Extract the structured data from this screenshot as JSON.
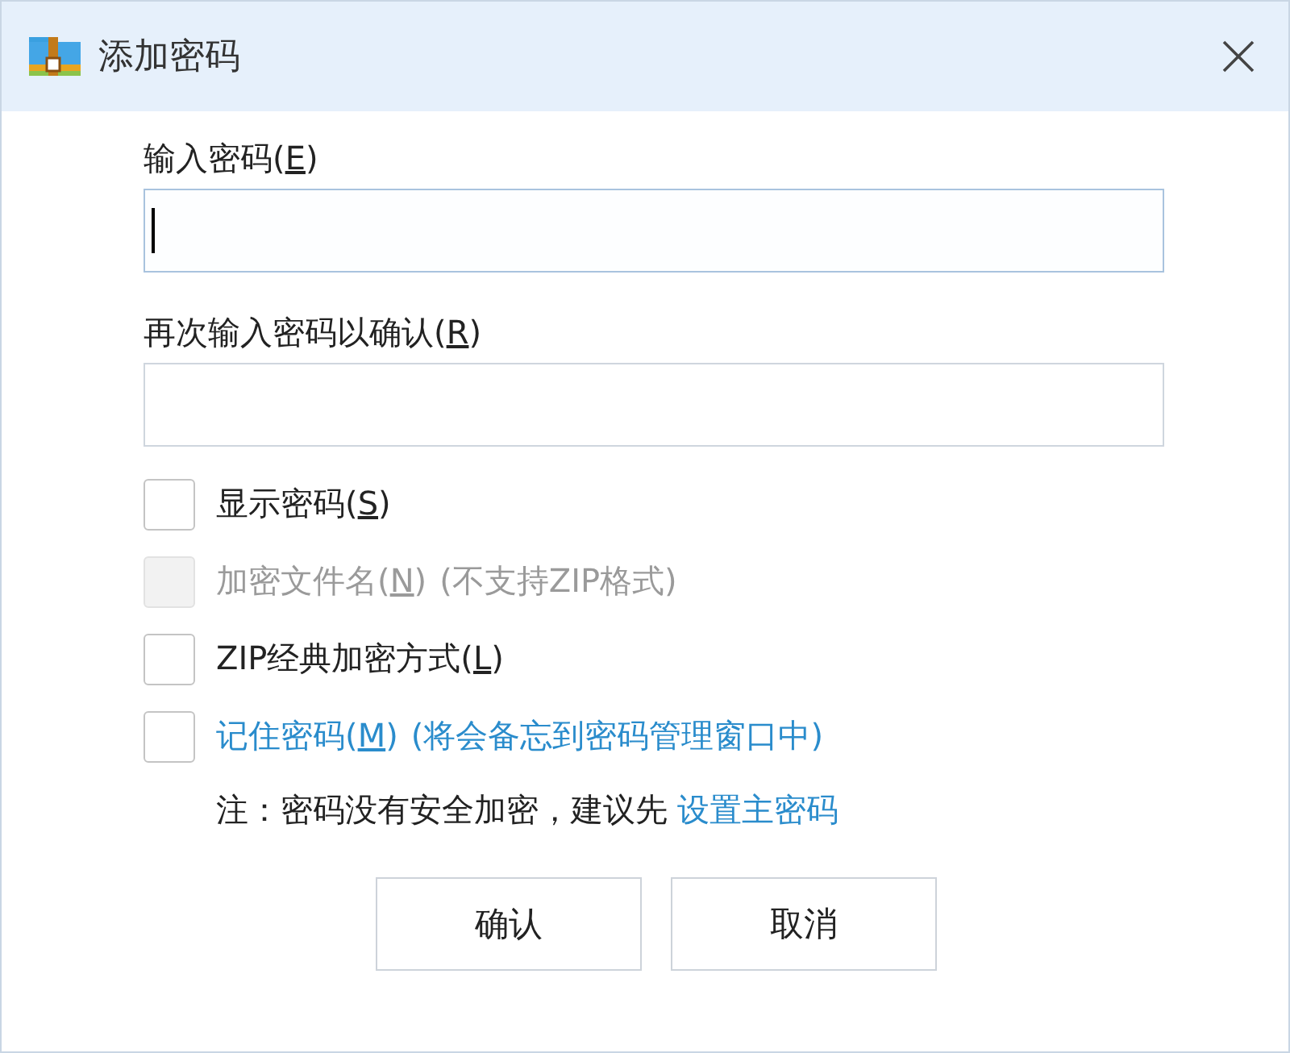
{
  "window": {
    "title": "添加密码"
  },
  "fields": [
    {
      "label_before": "输入密码(",
      "access_key": "E",
      "label_after": ")",
      "focused": true
    },
    {
      "label_before": "再次输入密码以确认(",
      "access_key": "R",
      "label_after": ")",
      "focused": false
    }
  ],
  "options": [
    {
      "kind": "normal",
      "label_before": "显示密码(",
      "access_key": "S",
      "label_after": ")",
      "checked": false,
      "disabled": false
    },
    {
      "kind": "normal",
      "label_before": "加密文件名(",
      "access_key": "N",
      "label_after": ")",
      "extra": "(不支持ZIP格式)",
      "checked": false,
      "disabled": true
    },
    {
      "kind": "normal",
      "label_before": "ZIP经典加密方式(",
      "access_key": "L",
      "label_after": ")",
      "checked": false,
      "disabled": false
    },
    {
      "kind": "link",
      "label_before": "记住密码(",
      "access_key": "M",
      "label_after": ")",
      "extra": "(将会备忘到密码管理窗口中)",
      "checked": false,
      "disabled": false
    }
  ],
  "note": {
    "text": "注：密码没有安全加密，建议先",
    "link": "设置主密码"
  },
  "buttons": [
    "确认",
    "取消"
  ]
}
